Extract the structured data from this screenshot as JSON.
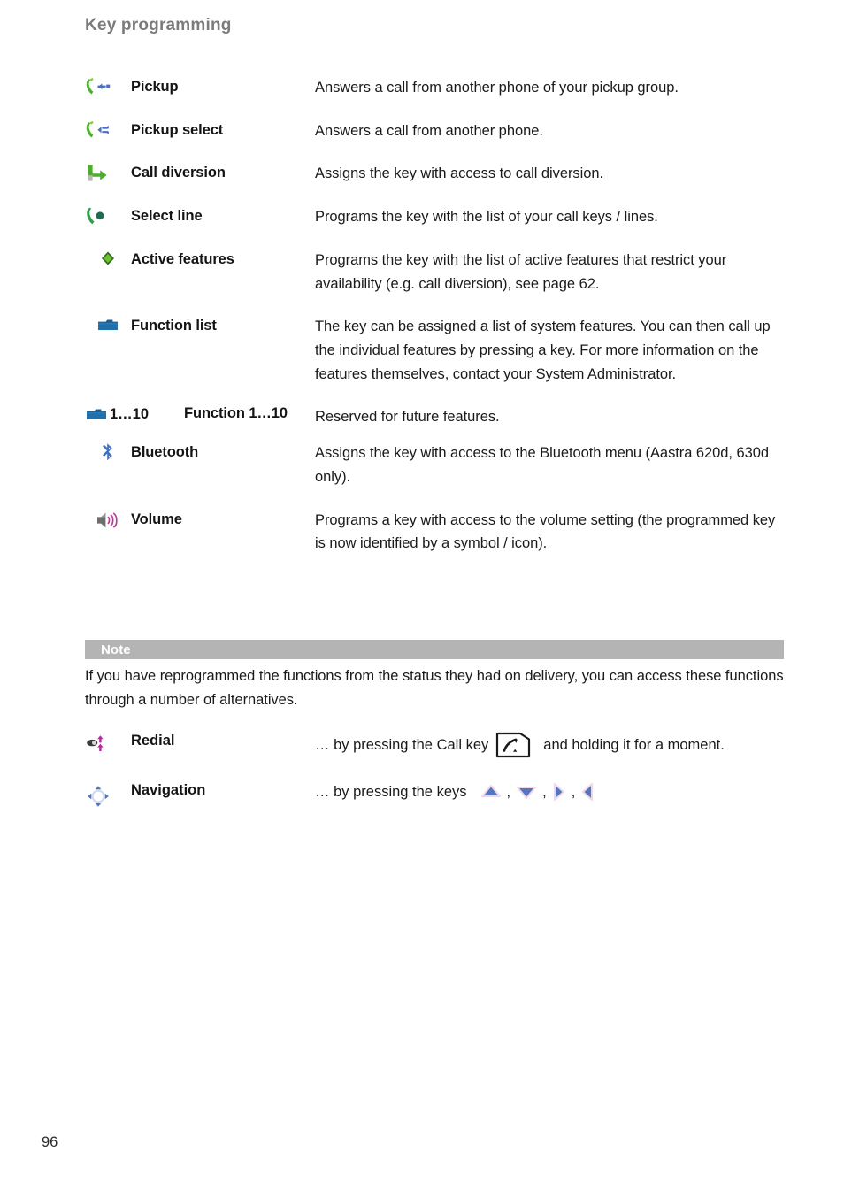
{
  "header": {
    "running_title": "Key programming"
  },
  "features": [
    {
      "icon": "pickup-icon",
      "name": "Pickup",
      "description": "Answers a call from another phone of your pickup group."
    },
    {
      "icon": "pickup-select-icon",
      "name": "Pickup select",
      "description": "Answers a call from another phone."
    },
    {
      "icon": "call-diversion-icon",
      "name": "Call diversion",
      "description": "Assigns the key with access to call diversion."
    },
    {
      "icon": "select-line-icon",
      "name": "Select line",
      "description": "Programs the key with the list of your call keys / lines."
    },
    {
      "icon": "active-features-icon",
      "name": "Active features",
      "description": "Programs the key with the list of active features that restrict your availability (e.g. call diversion), see page 62."
    },
    {
      "icon": "function-list-icon",
      "name": "Function list",
      "description": "The key can be assigned a list of system features. You can then call up the individual features by pressing a key. For more information on the features themselves, contact your System Administrator."
    }
  ],
  "function_range_row": {
    "icon": "function-list-icon",
    "icon_suffix": "1…10",
    "name": "Function 1…10",
    "description": "Reserved for future features."
  },
  "features_tail": [
    {
      "icon": "bluetooth-icon",
      "name": "Bluetooth",
      "description": "Assigns the key with access to the Bluetooth menu (Aastra 620d, 630d only)."
    },
    {
      "icon": "volume-icon",
      "name": "Volume",
      "description": "Programs a key with access to the volume setting (the programmed key is now identified by a symbol / icon)."
    }
  ],
  "note": {
    "label": "Note",
    "text": "If you have reprogrammed the functions from the status they had on delivery, you can access these functions through a number of alternatives."
  },
  "alternatives": [
    {
      "icon": "redial-icon",
      "name": "Redial",
      "text_before": "… by pressing the Call key",
      "inline_icon": "call-key-icon",
      "text_after": "and holding it for a moment."
    },
    {
      "icon": "navigation-icon",
      "name": "Navigation",
      "text_before": "… by pressing the keys",
      "inline_icons": [
        "arrow-up-icon",
        "arrow-down-icon",
        "arrow-right-icon",
        "arrow-left-icon"
      ],
      "separator": ","
    }
  ],
  "footer": {
    "page_number": "96"
  },
  "colors": {
    "handset_green": "#4caf2a",
    "arrow_blue": "#4a6fc4",
    "diamond_green": "#5cb82a",
    "folder_blue": "#1b5e94",
    "bluetooth_blue": "#3f6fc0",
    "volume_magenta": "#c0369d",
    "redial_magenta": "#b02aa0",
    "nav_blue": "#5576bf",
    "note_bar_gray": "#b4b4b4",
    "running_head_gray": "#7b7b7b",
    "select_line_dark": "#1f6b52"
  }
}
